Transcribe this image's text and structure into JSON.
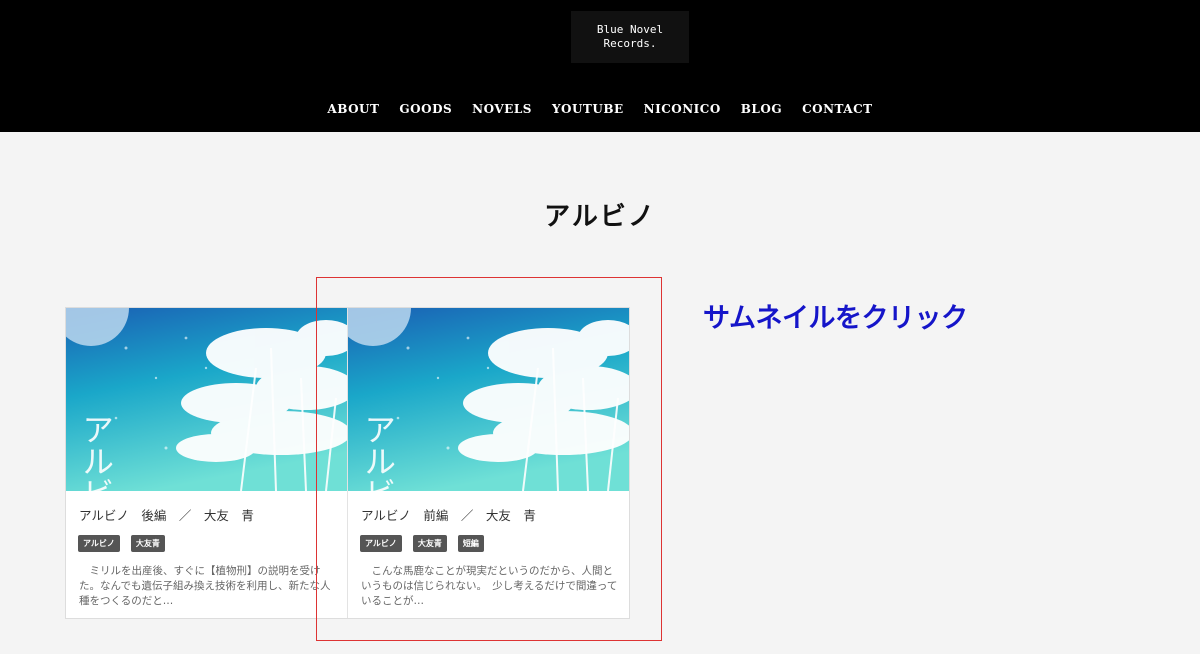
{
  "header": {
    "logo_line1": "Blue Novel",
    "logo_line2": "Records.",
    "nav": [
      "ABOUT",
      "GOODS",
      "NOVELS",
      "YOUTUBE",
      "NICONICO",
      "BLOG",
      "CONTACT"
    ]
  },
  "page_title": "アルビノ",
  "cards": [
    {
      "title": "アルビノ　後編　／　大友　青",
      "tags": [
        "アルビノ",
        "大友青"
      ],
      "excerpt": "　ミリルを出産後、すぐに【植物刑】の説明を受けた。なんでも遺伝子組み換え技術を利用し、新たな人種をつくるのだと…",
      "thumb_text": "アルビ"
    },
    {
      "title": "アルビノ　前編　／　大友　青",
      "tags": [
        "アルビノ",
        "大友青",
        "短編"
      ],
      "excerpt": "　こんな馬鹿なことが現実だというのだから、人間というものは信じられない。　少し考えるだけで間違っていることが…",
      "thumb_text": "アルビ"
    }
  ],
  "callout": "サムネイルをクリック",
  "colors": {
    "header_bg": "#000000",
    "callout": "#1515c9",
    "highlight": "#dd3333",
    "tag_bg": "#555555"
  }
}
